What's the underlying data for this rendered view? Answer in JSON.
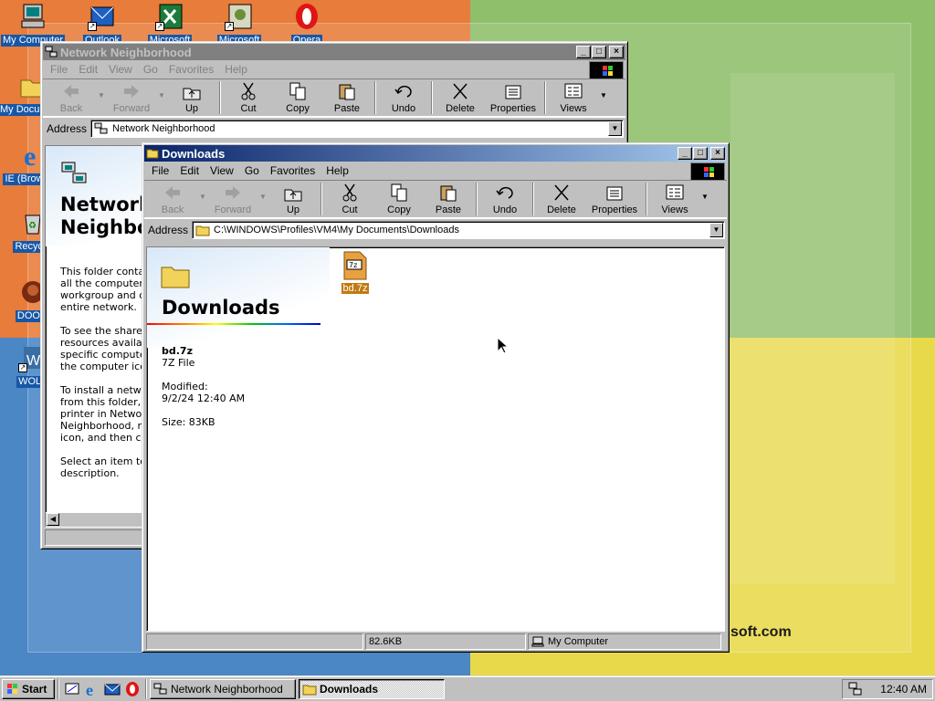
{
  "desktop": {
    "icons": [
      {
        "label": "My Computer"
      },
      {
        "label": "Outlook"
      },
      {
        "label": "Microsoft"
      },
      {
        "label": "Microsoft"
      },
      {
        "label": "Opera"
      },
      {
        "label": "My Documents"
      },
      {
        "label": "IE (Browser)"
      },
      {
        "label": "Recycle"
      },
      {
        "label": "DOOM"
      },
      {
        "label": "WOLF"
      }
    ],
    "wallpaper_text": "soft.com"
  },
  "menu": [
    "File",
    "Edit",
    "View",
    "Go",
    "Favorites",
    "Help"
  ],
  "toolbar": [
    "Back",
    "Forward",
    "Up",
    "Cut",
    "Copy",
    "Paste",
    "Undo",
    "Delete",
    "Properties",
    "Views"
  ],
  "address_label": "Address",
  "network_window": {
    "title": "Network Neighborhood",
    "address": "Network Neighborhood",
    "panel_title": "Network\nNeighborhood",
    "panel_text_1": "This folder contains links to\nall the computers in your\nworkgroup and on the\nentire network.",
    "panel_text_2": "To see the shared\nresources available on a\nspecific computer, double-click\nthe computer icon.",
    "panel_text_3": "To install a network printer\nfrom this folder, open the\nprinter in Network\nNeighborhood, right-click the\nicon, and then click Install.",
    "panel_text_4": "Select an item to view its\ndescription."
  },
  "downloads_window": {
    "title": "Downloads",
    "address": "C:\\WINDOWS\\Profiles\\VM4\\My Documents\\Downloads",
    "panel_title": "Downloads",
    "file_name": "bd.7z",
    "file_type": "7Z File",
    "modified_label": "Modified:",
    "modified_value": "9/2/24 12:40 AM",
    "size": "Size: 83KB",
    "item": {
      "label": "bd.7z",
      "icon_text": "7z"
    },
    "status_size": "82.6KB",
    "status_zone": "My Computer"
  },
  "taskbar": {
    "start": "Start",
    "tasks": [
      {
        "label": "Network Neighborhood",
        "pressed": false
      },
      {
        "label": "Downloads",
        "pressed": true
      }
    ],
    "clock": "12:40 AM"
  },
  "colors": {
    "title_active": "#0a246a",
    "title_inactive": "#808080",
    "desktop_teal": "#3a6ea5"
  }
}
